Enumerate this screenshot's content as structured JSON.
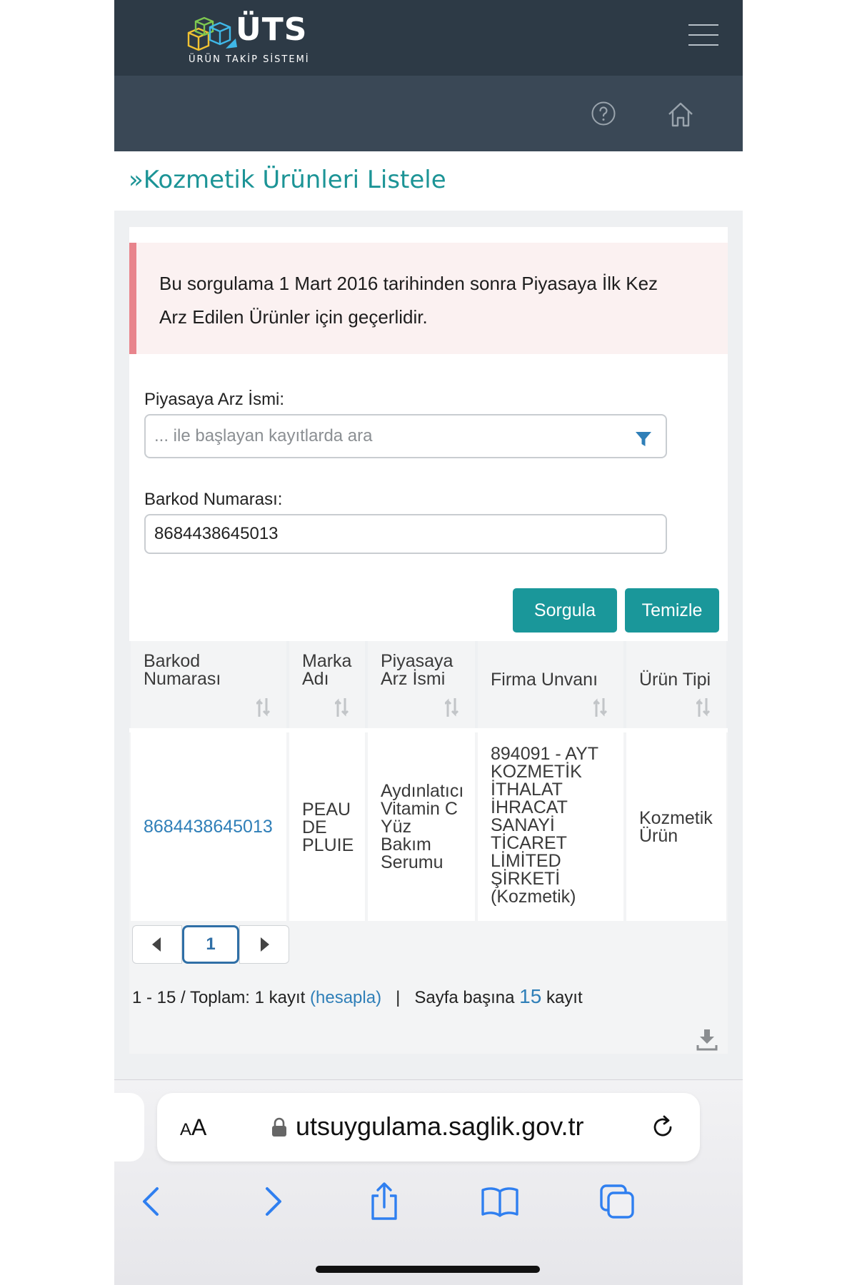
{
  "header": {
    "logo_title": "ÜTS",
    "logo_subtitle": "ÜRÜN TAKİP SİSTEMİ",
    "icons": [
      "hamburger-menu-icon",
      "help-icon",
      "home-icon"
    ]
  },
  "page": {
    "title": "»Kozmetik Ürünleri Listele"
  },
  "alert": {
    "text": "Bu sorgulama 1 Mart 2016 tarihinden sonra Piyasaya İlk Kez Arz Edilen Ürünler için geçerlidir."
  },
  "form": {
    "name_label": "Piyasaya Arz İsmi:",
    "name_placeholder": "... ile başlayan kayıtlarda ara",
    "name_value": "",
    "barcode_label": "Barkod Numarası:",
    "barcode_value": "8684438645013",
    "query_button": "Sorgula",
    "clear_button": "Temizle"
  },
  "table": {
    "columns": [
      "Barkod Numarası",
      "Marka Adı",
      "Piyasaya Arz İsmi",
      "Firma Unvanı",
      "Ürün Tipi"
    ],
    "rows": [
      [
        "8684438645013",
        "PEAU DE PLUIE",
        "Aydınlatıcı Vitamin C Yüz Bakım Serumu",
        "894091 - AYT KOZMETİK İTHALAT İHRACAT SANAYİ TİCARET LİMİTED ŞİRKETİ (Kozmetik)",
        "Kozmetik Ürün"
      ]
    ]
  },
  "pagination": {
    "current_page": "1",
    "range_text": "1 - 15 / Toplam: 1 kayıt",
    "calc_link": "(hesapla)",
    "separator": "|",
    "per_page_label": "Sayfa başına",
    "per_page_value": "15",
    "per_page_suffix": "kayıt"
  },
  "browser": {
    "text_size_label_small": "A",
    "text_size_label_large": "A",
    "url": "utsuygulama.saglik.gov.tr"
  },
  "colors": {
    "header_bg": "#2d3a46",
    "subheader_bg": "#3a4856",
    "accent_teal": "#1a979a",
    "link_blue": "#2f7fb8",
    "alert_bar": "#e8848c",
    "alert_bg": "#fbf1f1"
  }
}
